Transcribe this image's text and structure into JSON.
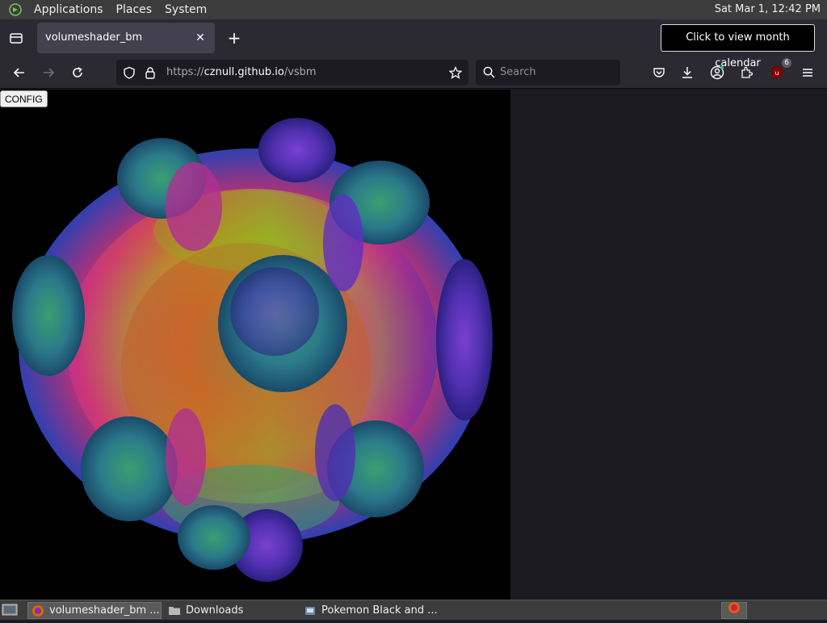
{
  "top_panel": {
    "menus": [
      "Applications",
      "Places",
      "System"
    ],
    "clock": "Sat Mar  1, 12:42 PM",
    "clock_tooltip": "Click to view month calendar"
  },
  "browser": {
    "tab": {
      "title": "volumeshader_bm",
      "close_glyph": "✕"
    },
    "new_tab_glyph": "+",
    "url": {
      "scheme": "https://",
      "host": "cznull.github.io",
      "path": "/vsbm"
    },
    "search_placeholder": "Search",
    "extension_badge": "6"
  },
  "page": {
    "config_button": "CONFIG"
  },
  "taskbar": {
    "items": [
      "volumeshader_bm ...",
      "Downloads",
      "Pokemon Black and ..."
    ]
  },
  "colors": {
    "panel": "#3c3c3c",
    "tabbar": "#2b2a33",
    "content_bg": "#1c1b22",
    "canvas_bg": "#000000"
  }
}
